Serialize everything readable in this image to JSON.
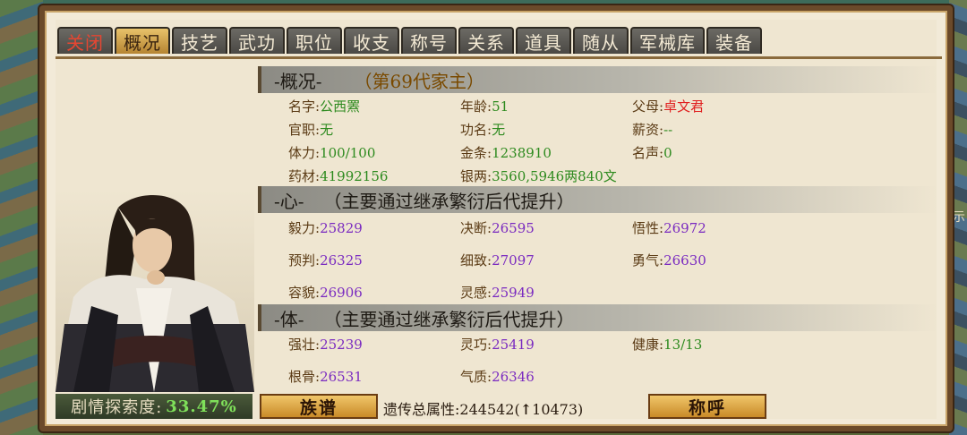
{
  "tabs": [
    {
      "label": "关闭",
      "state": "close"
    },
    {
      "label": "概况",
      "state": "active"
    },
    {
      "label": "技艺",
      "state": "normal"
    },
    {
      "label": "武功",
      "state": "normal"
    },
    {
      "label": "职位",
      "state": "normal"
    },
    {
      "label": "收支",
      "state": "normal"
    },
    {
      "label": "称号",
      "state": "normal"
    },
    {
      "label": "关系",
      "state": "normal"
    },
    {
      "label": "道具",
      "state": "normal"
    },
    {
      "label": "随从",
      "state": "normal"
    },
    {
      "label": "军械库",
      "state": "normal"
    },
    {
      "label": "装备",
      "state": "normal"
    }
  ],
  "overview": {
    "section_title": "-概况-",
    "generation": "（第69代家主）",
    "name_label": "名字:",
    "name": "公西罴",
    "age_label": "年龄:",
    "age": "51",
    "parent_label": "父母:",
    "parent": "卓文君",
    "office_label": "官职:",
    "office": "无",
    "merit_label": "功名:",
    "merit": "无",
    "salary_label": "薪资:",
    "salary": "--",
    "stamina_label": "体力:",
    "stamina": "100/100",
    "gold_label": "金条:",
    "gold": "1238910",
    "fame_label": "名声:",
    "fame": "0",
    "herbs_label": "药材:",
    "herbs": "41992156",
    "silver_label": "银两:",
    "silver": "3560,5946两840文"
  },
  "heart": {
    "section_title": "-心-",
    "hint": "（主要通过继承繁衍后代提升）",
    "perseverance_label": "毅力:",
    "perseverance": "25829",
    "decisiveness_label": "决断:",
    "decisiveness": "26595",
    "insight_label": "悟性:",
    "insight": "26972",
    "foresight_label": "预判:",
    "foresight": "26325",
    "delicacy_label": "细致:",
    "delicacy": "27097",
    "courage_label": "勇气:",
    "courage": "26630",
    "appearance_label": "容貌:",
    "appearance": "26906",
    "inspiration_label": "灵感:",
    "inspiration": "25949"
  },
  "body": {
    "section_title": "-体-",
    "hint": "（主要通过继承繁衍后代提升）",
    "strength_label": "强壮:",
    "strength": "25239",
    "agility_label": "灵巧:",
    "agility": "25419",
    "health_label": "健康:",
    "health": "13/13",
    "bone_label": "根骨:",
    "bone": "26531",
    "temperament_label": "气质:",
    "temperament": "26346"
  },
  "footer": {
    "explore_label": "剧情探索度:",
    "explore_pct": "33.47%",
    "zupu_button": "族谱",
    "genetic_label": "遗传总属性:",
    "genetic_value": "244542(",
    "genetic_arrow": "↑",
    "genetic_gain": "10473)",
    "chenghu_button": "称呼"
  },
  "side_text": "示",
  "colors": {
    "green_value": "#2d8a1e",
    "purple_value": "#7a2ac0",
    "red_value": "#e01e1e",
    "gold_button": "#e0a84a"
  }
}
